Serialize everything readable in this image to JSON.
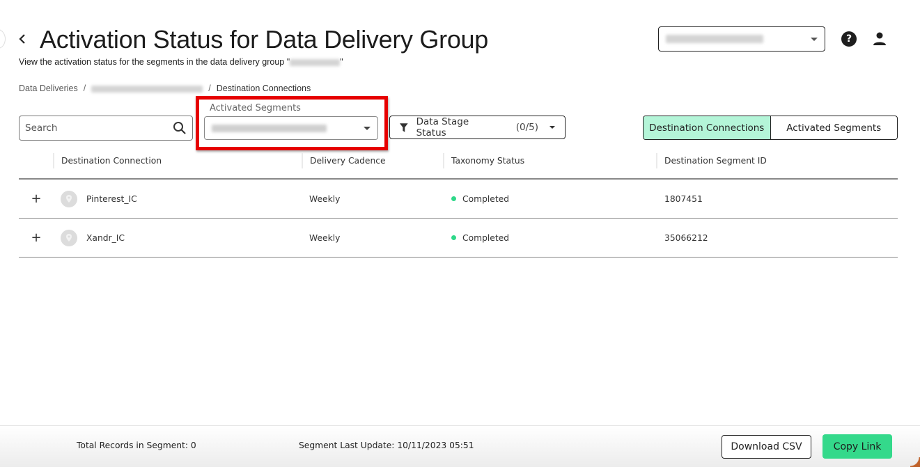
{
  "header": {
    "back_label": "Back",
    "title": "Activation Status for Data Delivery Group",
    "subtitle_prefix": "View the activation status for the segments in the data delivery group \"",
    "subtitle_suffix": "\"",
    "account_select": {
      "value": "[redacted account]"
    }
  },
  "breadcrumb": {
    "items": [
      {
        "label": "Data Deliveries"
      },
      {
        "label": "[redacted delivery]"
      },
      {
        "label": "Destination Connections"
      }
    ],
    "separator": "/"
  },
  "filters": {
    "search_placeholder": "Search",
    "activated_segments_label": "Activated Segments",
    "activated_segments_value": "[redacted segment]",
    "data_stage_status_label": "Data Stage Status",
    "data_stage_status_count": "(0/5)"
  },
  "view_toggle": {
    "tabs": [
      {
        "label": "Destination Connections",
        "active": true
      },
      {
        "label": "Activated Segments",
        "active": false
      }
    ]
  },
  "table": {
    "columns": [
      "Destination Connection",
      "Delivery Cadence",
      "Taxonomy Status",
      "Destination Segment ID"
    ],
    "rows": [
      {
        "expand": "+",
        "connection": "Pinterest_IC",
        "cadence": "Weekly",
        "status": "Completed",
        "segment_id": "1807451"
      },
      {
        "expand": "+",
        "connection": "Xandr_IC",
        "cadence": "Weekly",
        "status": "Completed",
        "segment_id": "35066212"
      }
    ]
  },
  "footer": {
    "total_records": "Total Records in Segment: 0",
    "last_update": "Segment Last Update: 10/11/2023 05:51",
    "download_label": "Download CSV",
    "copy_label": "Copy Link"
  },
  "colors": {
    "accent_green": "#34d98b",
    "active_tab_bg": "#b4f5d8",
    "status_completed": "#2ed889",
    "highlight_red": "#e60000"
  }
}
